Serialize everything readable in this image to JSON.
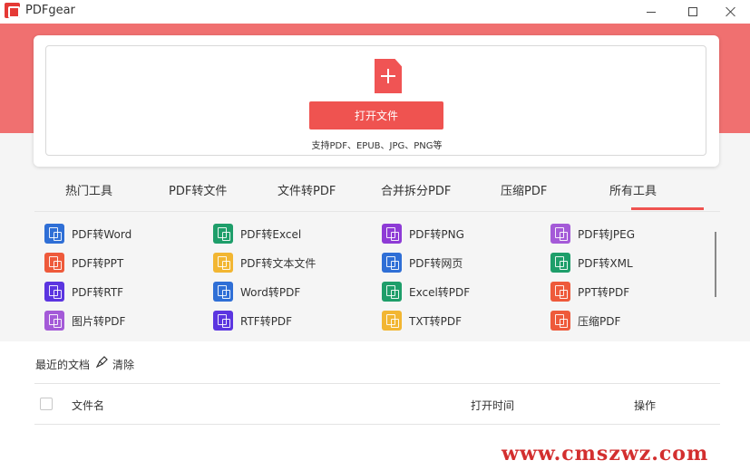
{
  "window": {
    "title": "PDFgear"
  },
  "upload": {
    "open_button": "打开文件",
    "support_text": "支持PDF、EPUB、JPG、PNG等"
  },
  "tabs": [
    {
      "label": "热门工具"
    },
    {
      "label": "PDF转文件"
    },
    {
      "label": "文件转PDF"
    },
    {
      "label": "合并拆分PDF"
    },
    {
      "label": "压缩PDF"
    },
    {
      "label": "所有工具",
      "active": true
    }
  ],
  "tools": [
    {
      "label": "PDF转Word",
      "color": "#2f6fd6"
    },
    {
      "label": "PDF转Excel",
      "color": "#1e9e6a"
    },
    {
      "label": "PDF转PNG",
      "color": "#8e3bd6"
    },
    {
      "label": "PDF转JPEG",
      "color": "#a45ad8"
    },
    {
      "label": "PDF转PPT",
      "color": "#ee5a3b"
    },
    {
      "label": "PDF转文本文件",
      "color": "#f2b632"
    },
    {
      "label": "PDF转网页",
      "color": "#2f6fd6"
    },
    {
      "label": "PDF转XML",
      "color": "#1e9e6a"
    },
    {
      "label": "PDF转RTF",
      "color": "#5b35e0"
    },
    {
      "label": "Word转PDF",
      "color": "#2f6fd6"
    },
    {
      "label": "Excel转PDF",
      "color": "#1e9e6a"
    },
    {
      "label": "PPT转PDF",
      "color": "#ee5a3b"
    },
    {
      "label": "图片转PDF",
      "color": "#a45ad8"
    },
    {
      "label": "RTF转PDF",
      "color": "#5b35e0"
    },
    {
      "label": "TXT转PDF",
      "color": "#f2b632"
    },
    {
      "label": "压缩PDF",
      "color": "#ee5a3b"
    }
  ],
  "recent": {
    "title": "最近的文档",
    "clear_label": "清除",
    "columns": {
      "name": "文件名",
      "time": "打开时间",
      "action": "操作"
    }
  },
  "watermark": "www.cmszwz.com",
  "colors": {
    "brand_red": "#f07070",
    "button_red": "#ef5350"
  }
}
